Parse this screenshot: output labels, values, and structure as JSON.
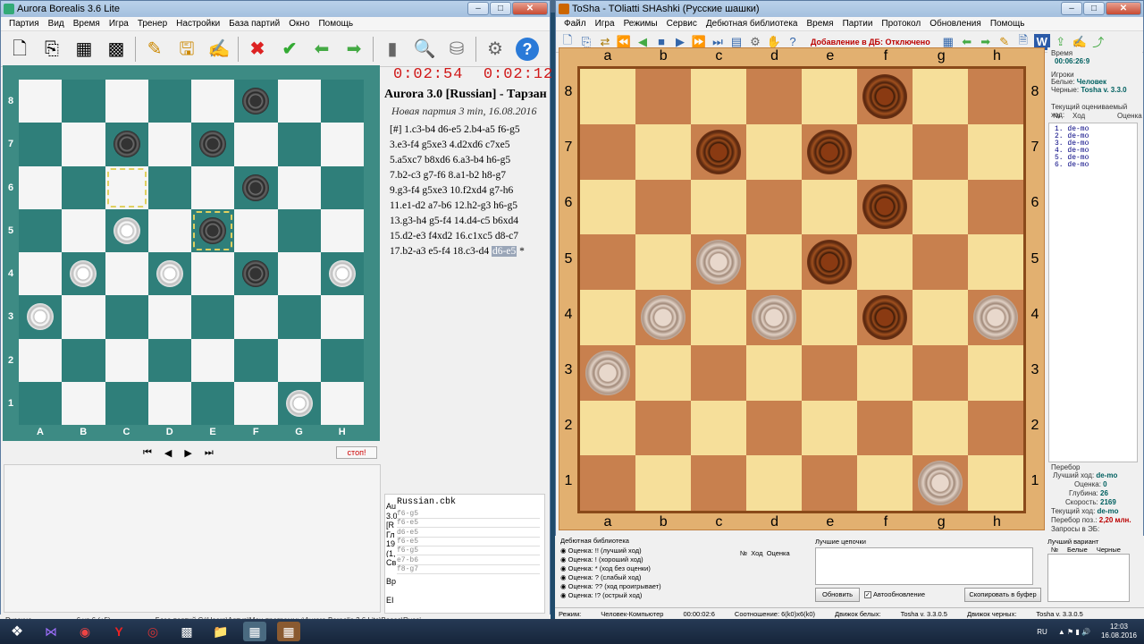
{
  "left_window": {
    "title": "Aurora Borealis 3.6 Lite",
    "menu": [
      "Партия",
      "Вид",
      "Время",
      "Игра",
      "Тренер",
      "Настройки",
      "База партий",
      "Окно",
      "Помощь"
    ],
    "clock_white": "0:02:54",
    "clock_black": "0:02:12",
    "game_title": "Aurora 3.0 [Russian] - Тарзан",
    "game_subtitle": "Новая партия 3 min, 16.08.2016",
    "moves": [
      "[#] 1.c3-b4 d6-e5 2.b4-a5 f6-g5",
      "3.e3-f4 g5xe3 4.d2xd6 c7xe5",
      "5.a5xc7 b8xd6 6.a3-b4 h6-g5",
      "7.b2-c3 g7-f6 8.a1-b2 h8-g7",
      "9.g3-f4 g5xe3 10.f2xd4 g7-h6",
      "11.e1-d2 a7-b6 12.h2-g3 h6-g5",
      "13.g3-h4 g5-f4 14.d4-c5 b6xd4",
      "15.d2-e3 f4xd2 16.c1xc5 d8-c7"
    ],
    "last_move_line": "17.b2-a3 e5-f4 18.c3-d4",
    "current_move": "d6-e5",
    "result_mark": "*",
    "files": [
      "A",
      "B",
      "C",
      "D",
      "E",
      "F",
      "G",
      "H"
    ],
    "ranks": [
      "8",
      "7",
      "6",
      "5",
      "4",
      "3",
      "2",
      "1"
    ],
    "stop_label": "стоп!",
    "db_file": "Russian.cbk",
    "db_rows": [
      "f6-g5",
      "f6-e5",
      "d6-e5",
      "f6-e5",
      "f6-g5",
      "e7-b6",
      "f8-g7"
    ],
    "db_side_letters": [
      "Au",
      "3.0",
      "[R",
      "Гл",
      "19",
      "(1,",
      "Св",
      "",
      "Вр",
      "",
      "EI"
    ],
    "status": [
      "Русские",
      "6 vs 6 (+5)",
      "База партий C:\\Users\\Артур\\Мои программы\\Aurora Borealis 3.6 Lite\\Bases\\Russi"
    ]
  },
  "board1": [
    [
      ".",
      "L",
      ".",
      "L",
      ".",
      "B",
      ".",
      "L"
    ],
    [
      "L",
      ".",
      "B",
      ".",
      "B",
      ".",
      "L",
      "."
    ],
    [
      ".",
      "L",
      "H",
      "L",
      ".",
      "B",
      ".",
      "L"
    ],
    [
      "L",
      ".",
      "W",
      ".",
      "BH",
      ".",
      "L",
      "."
    ],
    [
      ".",
      "W",
      ".",
      "W",
      ".",
      "B",
      ".",
      "W"
    ],
    [
      "W",
      ".",
      "L",
      ".",
      "L",
      ".",
      "L",
      "."
    ],
    [
      ".",
      "L",
      ".",
      "L",
      ".",
      "L",
      ".",
      "L"
    ],
    [
      "L",
      ".",
      "L",
      ".",
      "L",
      ".",
      "W",
      "."
    ]
  ],
  "right_window": {
    "title": "ToSha - TOliatti SHAshki (Русские шашки)",
    "menu": [
      "Файл",
      "Игра",
      "Режимы",
      "Сервис",
      "Дебютная библиотека",
      "Время",
      "Партии",
      "Протокол",
      "Обновления",
      "Помощь"
    ],
    "db_status": "Добавление в ДБ: Отключено",
    "files": [
      "a",
      "b",
      "c",
      "d",
      "e",
      "f",
      "g",
      "h"
    ],
    "ranks": [
      "8",
      "7",
      "6",
      "5",
      "4",
      "3",
      "2",
      "1"
    ],
    "time_label": "Время",
    "time_value": "00:06:26:9",
    "players_label": "Игроки",
    "white_label": "Белые:",
    "white_player": "Человек",
    "black_label": "Черные:",
    "black_player": "Tosha v. 3.3.0",
    "cur_eval_label": "Текущий оцениваемый ход:",
    "eval_cols": [
      "№",
      "Ход",
      "Оценка"
    ],
    "eval_lines": [
      "1. de-mo",
      "2. de-mo",
      "3. de-mo",
      "4. de-mo",
      "5. de-mo",
      "6. de-mo"
    ],
    "search_label": "Перебор",
    "best_move_label": "Лучший ход:",
    "best_move": "de-mo",
    "score_label": "Оценка:",
    "score": "0",
    "depth_label": "Глубина:",
    "depth": "26",
    "speed_label": "Скорость:",
    "speed": "2169",
    "current_move_label": "Текущий ход:",
    "current_move": "de-mo",
    "nodes_label": "Перебор поз.:",
    "nodes": "2,20 млн.",
    "queries_label": "Запросы в ЭБ:",
    "debut_title": "Дебютная библиотека",
    "debut_items": [
      "Оценка: !! (лучший ход)",
      "Оценка: ! (хороший ход)",
      "Оценка: * (ход без оценки)",
      "Оценка: ? (слабый ход)",
      "Оценка: ?? (ход проигрывает)",
      "Оценка: !? (острый ход)"
    ],
    "debut_cols": [
      "№",
      "Ход",
      "Оценка"
    ],
    "chains_title": "Лучшие цепочки",
    "refresh_btn": "Обновить",
    "autoupdate": "Автообновление",
    "copy_btn": "Скопировать в буфер",
    "best_var_title": "Лучший вариант",
    "best_var_cols": [
      "№",
      "Белые",
      "Черные"
    ],
    "status": [
      "Режим:",
      "Человек-Компьютер",
      "00:00:02:6",
      "Соотношение: 6(k0)x6(k0)",
      "Движок белых:",
      "Tosha v. 3.3.0.5",
      "Движок черных:",
      "Tosha v. 3.3.0.5"
    ]
  },
  "board2": [
    [
      ".",
      "L",
      ".",
      "L",
      ".",
      "B",
      ".",
      "L"
    ],
    [
      "L",
      ".",
      "B",
      ".",
      "B",
      ".",
      "L",
      "."
    ],
    [
      ".",
      "L",
      ".",
      "L",
      ".",
      "B",
      ".",
      "L"
    ],
    [
      "L",
      ".",
      "W",
      ".",
      "B",
      ".",
      "L",
      "."
    ],
    [
      ".",
      "W",
      ".",
      "W",
      ".",
      "B",
      ".",
      "W"
    ],
    [
      "W",
      ".",
      "L",
      ".",
      "L",
      ".",
      "L",
      "."
    ],
    [
      ".",
      "L",
      ".",
      "L",
      ".",
      "L",
      ".",
      "L"
    ],
    [
      "L",
      ".",
      "L",
      ".",
      "L",
      ".",
      "W",
      "."
    ]
  ],
  "taskbar": {
    "lang": "RU",
    "time": "12:03",
    "date": "16.08.2016"
  }
}
